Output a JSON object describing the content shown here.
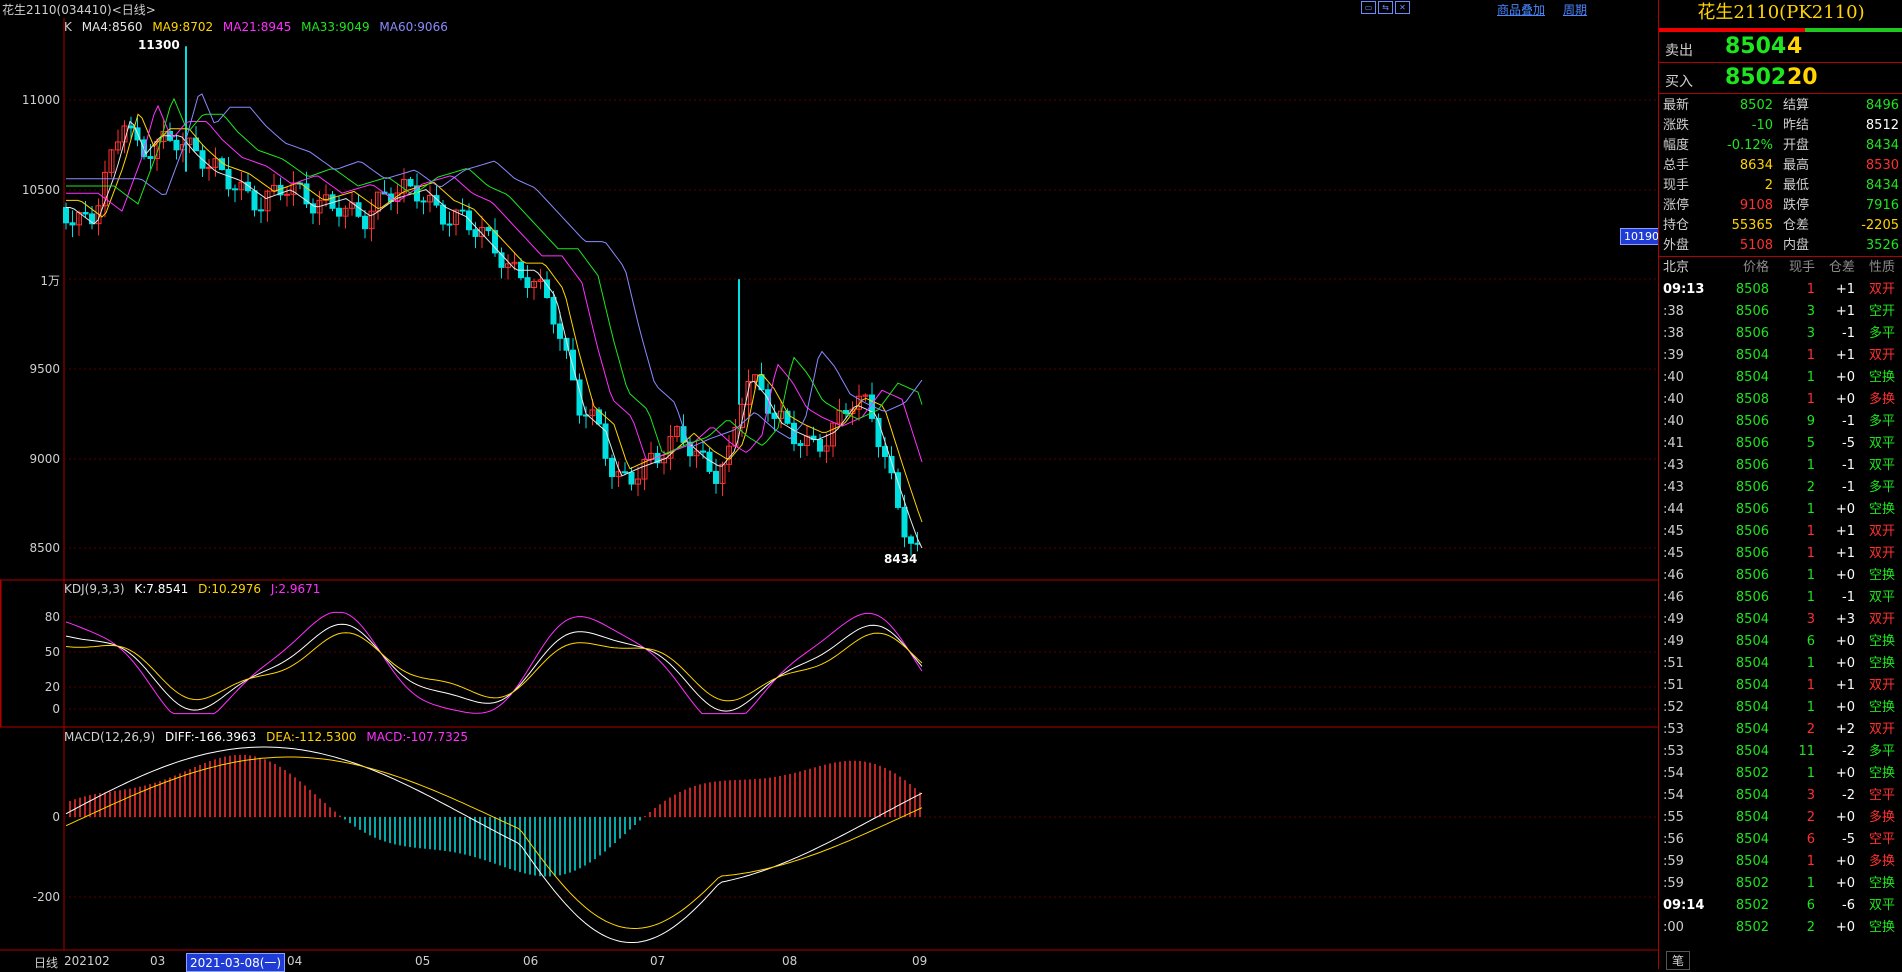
{
  "window": {
    "title": "花生2110(034410)<日线>",
    "links": [
      "商品叠加",
      "周期"
    ]
  },
  "main_legend": {
    "k": "K",
    "ma4": "MA4:8560",
    "ma9": "MA9:8702",
    "ma21": "MA21:8945",
    "ma33": "MA33:9049",
    "ma60": "MA60:9066"
  },
  "kdj_legend": {
    "name": "KDJ(9,3,3)",
    "k": "K:7.8541",
    "d": "D:10.2976",
    "j": "J:2.9671"
  },
  "macd_legend": {
    "name": "MACD(12,26,9)",
    "diff": "DIFF:-166.3963",
    "dea": "DEA:-112.5300",
    "macd": "MACD:-107.7325"
  },
  "price_axis": [
    "11000",
    "10500",
    "1万",
    "9500",
    "9000",
    "8500"
  ],
  "kdj_axis": [
    "80",
    "50",
    "20",
    "0"
  ],
  "macd_axis": [
    "0",
    "-200"
  ],
  "x_axis": {
    "period": "日线",
    "labels": [
      "202102",
      "03",
      "04",
      "05",
      "06",
      "07",
      "08",
      "09"
    ],
    "cursor_date": "2021-03-08(一)"
  },
  "annotations": {
    "high": "11300",
    "low": "8434",
    "price_tag": "10190"
  },
  "colors": {
    "ma4": "#e6e6e6",
    "ma9": "#ffd400",
    "ma21": "#ff30ff",
    "ma33": "#1ee61e",
    "ma60": "#8a8aff",
    "up": "#ff3030",
    "down": "#00e0e0"
  },
  "right": {
    "title": "花生2110(PK2110)",
    "sell": {
      "label": "卖出",
      "price": "8504",
      "volume": "4"
    },
    "buy": {
      "label": "买入",
      "price": "8502",
      "volume": "20"
    },
    "stats": [
      [
        "最新",
        "8502",
        "结算",
        "8496"
      ],
      [
        "涨跌",
        "-10",
        "昨结",
        "8512"
      ],
      [
        "幅度",
        "-0.12%",
        "开盘",
        "8434"
      ],
      [
        "总手",
        "8634",
        "最高",
        "8530"
      ],
      [
        "现手",
        "2",
        "最低",
        "8434"
      ],
      [
        "涨停",
        "9108",
        "跌停",
        "7916"
      ],
      [
        "持仓",
        "55365",
        "仓差",
        "-2205"
      ],
      [
        "外盘",
        "5108",
        "内盘",
        "3526"
      ]
    ],
    "tick_headers": [
      "北京",
      "价格",
      "现手",
      "仓差",
      "性质"
    ],
    "ticks": [
      [
        "09:13",
        "8508",
        "1",
        "+1",
        "双开"
      ],
      [
        ":38",
        "8506",
        "3",
        "+1",
        "空开"
      ],
      [
        ":38",
        "8506",
        "3",
        "-1",
        "多平"
      ],
      [
        ":39",
        "8504",
        "1",
        "+1",
        "双开"
      ],
      [
        ":40",
        "8504",
        "1",
        "+0",
        "空换"
      ],
      [
        ":40",
        "8508",
        "1",
        "+0",
        "多换"
      ],
      [
        ":40",
        "8506",
        "9",
        "-1",
        "多平"
      ],
      [
        ":41",
        "8506",
        "5",
        "-5",
        "双平"
      ],
      [
        ":43",
        "8506",
        "1",
        "-1",
        "双平"
      ],
      [
        ":43",
        "8506",
        "2",
        "-1",
        "多平"
      ],
      [
        ":44",
        "8506",
        "1",
        "+0",
        "空换"
      ],
      [
        ":45",
        "8506",
        "1",
        "+1",
        "双开"
      ],
      [
        ":45",
        "8506",
        "1",
        "+1",
        "双开"
      ],
      [
        ":46",
        "8506",
        "1",
        "+0",
        "空换"
      ],
      [
        ":46",
        "8506",
        "1",
        "-1",
        "双平"
      ],
      [
        ":49",
        "8504",
        "3",
        "+3",
        "双开"
      ],
      [
        ":49",
        "8504",
        "6",
        "+0",
        "空换"
      ],
      [
        ":51",
        "8504",
        "1",
        "+0",
        "空换"
      ],
      [
        ":51",
        "8504",
        "1",
        "+1",
        "双开"
      ],
      [
        ":52",
        "8504",
        "1",
        "+0",
        "空换"
      ],
      [
        ":53",
        "8504",
        "2",
        "+2",
        "双开"
      ],
      [
        ":53",
        "8504",
        "11",
        "-2",
        "多平"
      ],
      [
        ":54",
        "8502",
        "1",
        "+0",
        "空换"
      ],
      [
        ":54",
        "8504",
        "3",
        "-2",
        "空平"
      ],
      [
        ":55",
        "8504",
        "2",
        "+0",
        "多换"
      ],
      [
        ":56",
        "8504",
        "6",
        "-5",
        "空平"
      ],
      [
        ":59",
        "8504",
        "1",
        "+0",
        "多换"
      ],
      [
        ":59",
        "8502",
        "1",
        "+0",
        "空换"
      ],
      [
        "09:14",
        "8502",
        "6",
        "-6",
        "双平"
      ],
      [
        ":00",
        "8502",
        "2",
        "+0",
        "空换"
      ]
    ],
    "bottom_tab": "笔"
  }
}
